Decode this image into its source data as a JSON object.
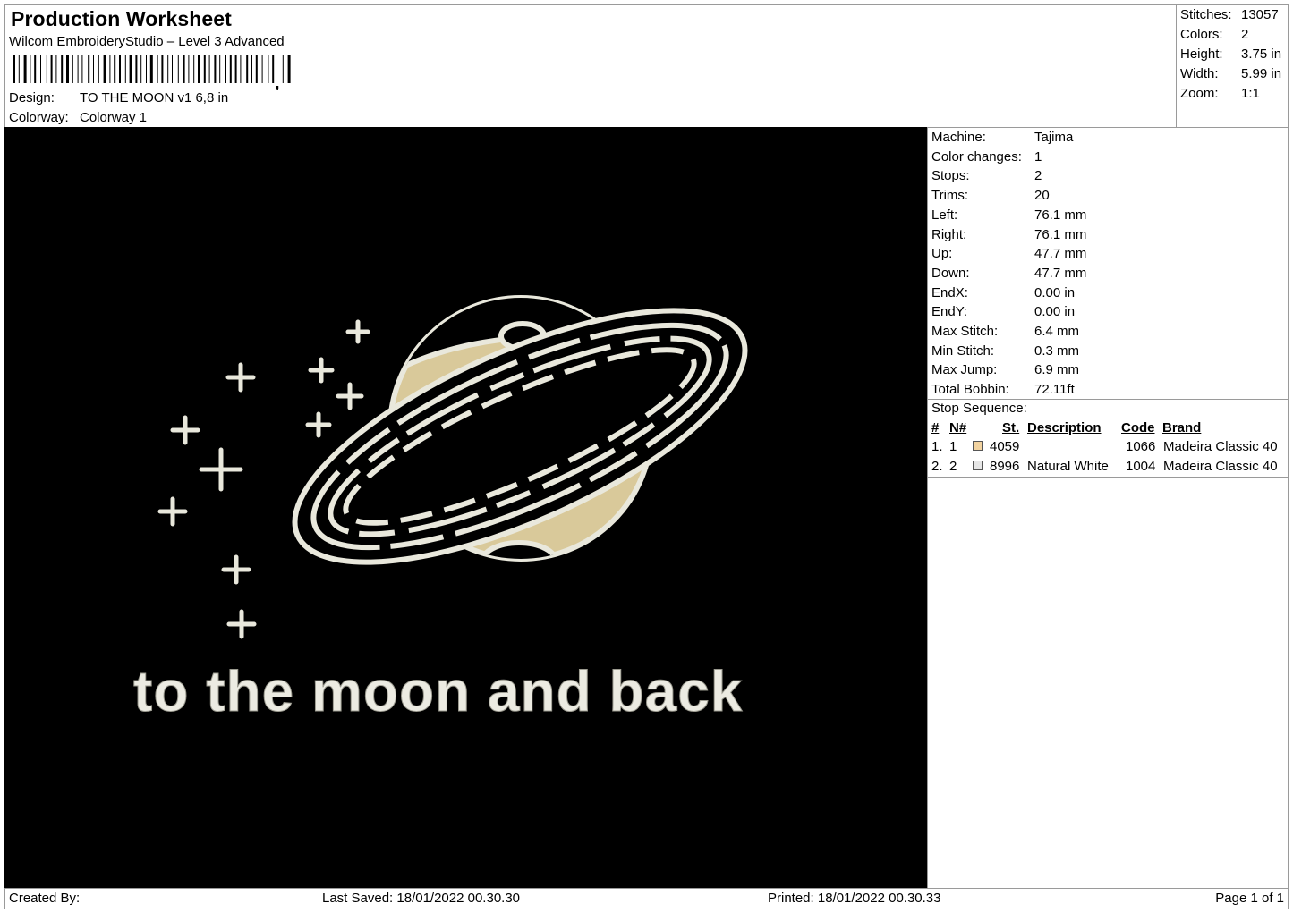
{
  "header": {
    "title": "Production Worksheet",
    "software": "Wilcom EmbroideryStudio – Level 3 Advanced",
    "design_label": "Design:",
    "design_value": "TO THE MOON v1 6,8 in",
    "colorway_label": "Colorway:",
    "colorway_value": "Colorway 1"
  },
  "summary": [
    {
      "label": "Stitches:",
      "value": "13057"
    },
    {
      "label": "Colors:",
      "value": "2"
    },
    {
      "label": "Height:",
      "value": "3.75 in"
    },
    {
      "label": "Width:",
      "value": "5.99 in"
    },
    {
      "label": "Zoom:",
      "value": "1:1"
    }
  ],
  "machine_info": [
    {
      "label": "Machine:",
      "value": "Tajima"
    },
    {
      "label": "Color changes:",
      "value": "1"
    },
    {
      "label": "Stops:",
      "value": "2"
    },
    {
      "label": "Trims:",
      "value": "20"
    },
    {
      "label": "Left:",
      "value": "76.1 mm"
    },
    {
      "label": "Right:",
      "value": "76.1 mm"
    },
    {
      "label": "Up:",
      "value": "47.7 mm"
    },
    {
      "label": "Down:",
      "value": "47.7 mm"
    },
    {
      "label": "EndX:",
      "value": "0.00 in"
    },
    {
      "label": "EndY:",
      "value": "0.00 in"
    },
    {
      "label": "Max Stitch:",
      "value": "6.4 mm"
    },
    {
      "label": "Min Stitch:",
      "value": "0.3 mm"
    },
    {
      "label": "Max Jump:",
      "value": "6.9 mm"
    },
    {
      "label": "Total Bobbin:",
      "value": "72.11ft"
    }
  ],
  "stop_sequence": {
    "title": "Stop Sequence:",
    "columns": [
      "#",
      "N#",
      "St.",
      "Description",
      "Code",
      "Brand"
    ],
    "rows": [
      {
        "num": "1.",
        "n": "1",
        "swatch": "#f2d3a0",
        "st": "4059",
        "description": "",
        "code": "1066",
        "brand": "Madeira Classic 40"
      },
      {
        "num": "2.",
        "n": "2",
        "swatch": "#e6e6e6",
        "st": "8996",
        "description": "Natural White",
        "code": "1004",
        "brand": "Madeira Classic 40"
      }
    ]
  },
  "design_preview": {
    "text": "to the moon and back",
    "background": "#000000",
    "thread_colors": {
      "planet_fill": "#d9c99a",
      "outline": "#e9e8dc"
    }
  },
  "footer": {
    "created_by": "Created By:",
    "last_saved": "Last Saved: 18/01/2022 00.30.30",
    "printed": "Printed: 18/01/2022 00.30.33",
    "page": "Page 1 of 1"
  }
}
